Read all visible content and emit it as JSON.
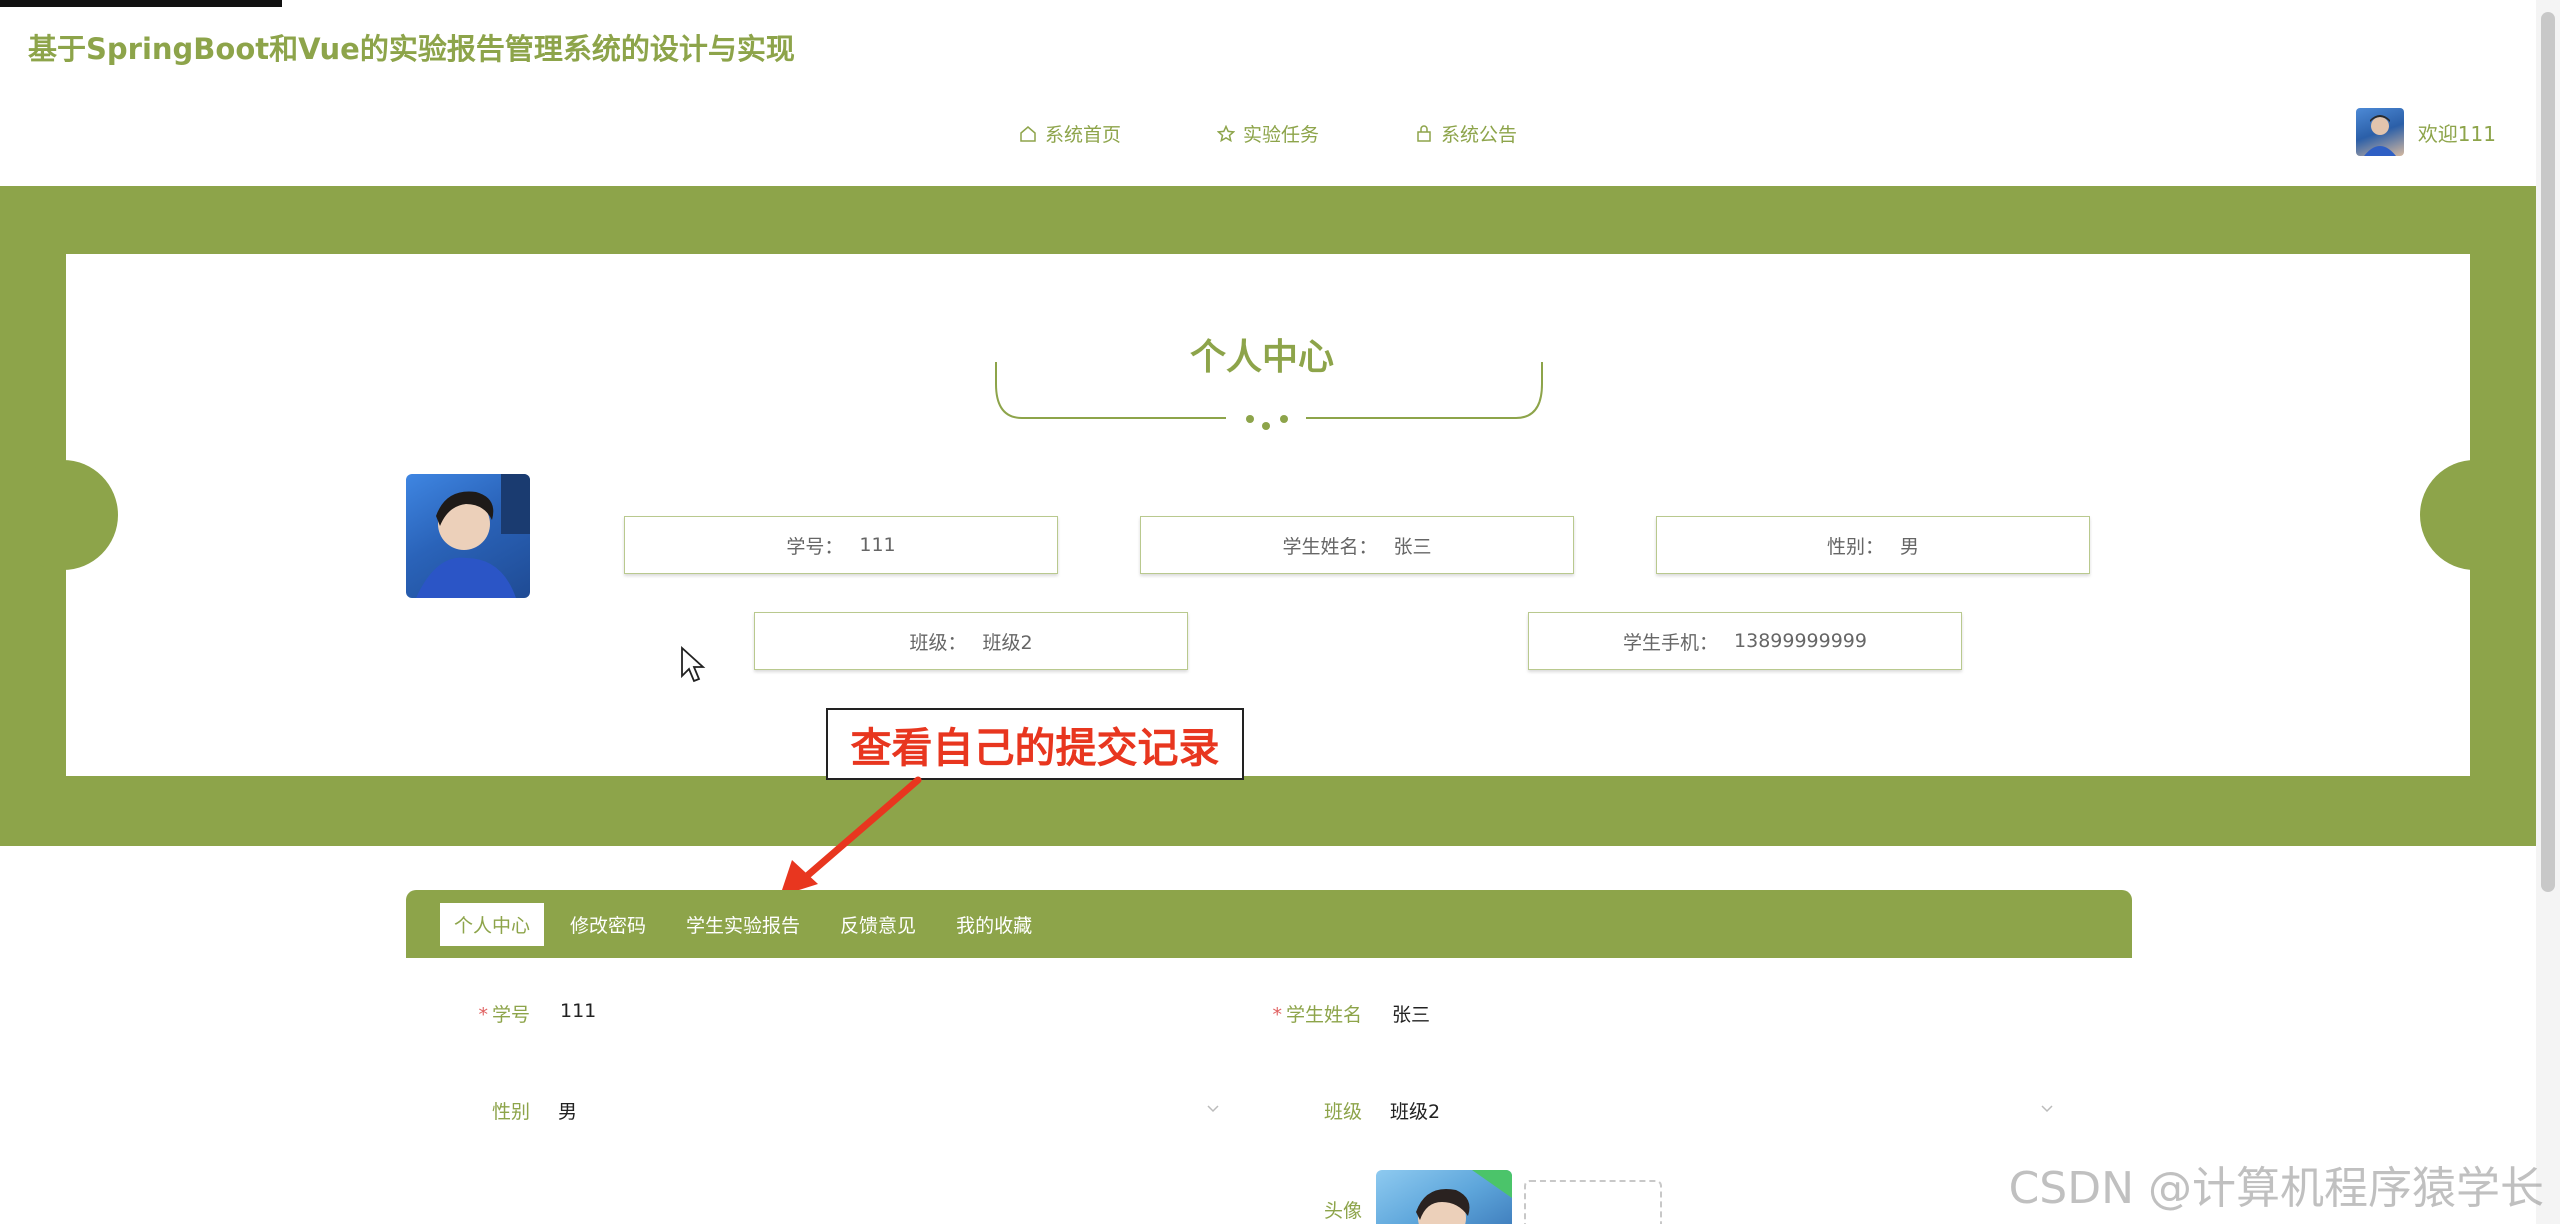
{
  "site": {
    "title": "基于SpringBoot和Vue的实验报告管理系统的设计与实现"
  },
  "nav": {
    "items": [
      {
        "label": "系统首页",
        "icon": "home-icon"
      },
      {
        "label": "实验任务",
        "icon": "star-icon"
      },
      {
        "label": "系统公告",
        "icon": "bag-icon"
      }
    ]
  },
  "user": {
    "welcome": "欢迎111"
  },
  "profile": {
    "section_title": "个人中心",
    "fields": [
      {
        "label": "学号：",
        "value": "111"
      },
      {
        "label": "学生姓名：",
        "value": "张三"
      },
      {
        "label": "性别：",
        "value": "男"
      },
      {
        "label": "班级：",
        "value": "班级2"
      },
      {
        "label": "学生手机：",
        "value": "13899999999"
      }
    ]
  },
  "callout": {
    "text": "查看自己的提交记录"
  },
  "tabs": [
    {
      "label": "个人中心",
      "active": true
    },
    {
      "label": "修改密码",
      "active": false
    },
    {
      "label": "学生实验报告",
      "active": false
    },
    {
      "label": "反馈意见",
      "active": false
    },
    {
      "label": "我的收藏",
      "active": false
    }
  ],
  "form": {
    "student_id": {
      "label": "学号",
      "required": true,
      "value": "111"
    },
    "student_name": {
      "label": "学生姓名",
      "required": true,
      "value": "张三"
    },
    "gender": {
      "label": "性别",
      "value": "男"
    },
    "class": {
      "label": "班级",
      "value": "班级2"
    },
    "avatar": {
      "label": "头像"
    }
  },
  "watermark": "CSDN @计算机程序猿学长",
  "colors": {
    "accent": "#8da44a",
    "callout_red": "#e8361f",
    "required": "#e06060"
  }
}
